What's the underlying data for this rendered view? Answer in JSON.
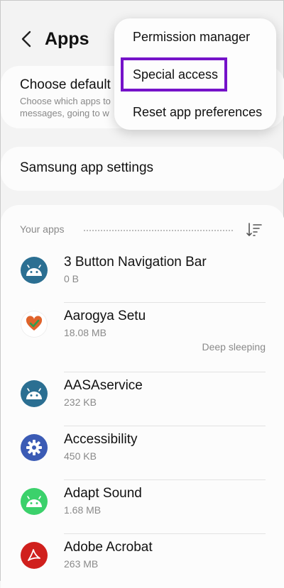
{
  "header": {
    "title": "Apps"
  },
  "choose_default": {
    "title": "Choose default",
    "subtitle": "Choose which apps to messages, going to w"
  },
  "samsung_settings": {
    "label": "Samsung app settings"
  },
  "your_apps": {
    "label": "Your apps"
  },
  "apps": [
    {
      "name": "3 Button Navigation Bar",
      "size": "0 B",
      "icon": "android-icon",
      "color": "#2b6f92"
    },
    {
      "name": "Aarogya Setu",
      "size": "18.08 MB",
      "status": "Deep sleeping",
      "icon": "heart-icon",
      "color": "#e0632b"
    },
    {
      "name": "AASAservice",
      "size": "232 KB",
      "icon": "android-icon",
      "color": "#2b6f92"
    },
    {
      "name": "Accessibility",
      "size": "450 KB",
      "icon": "gear-icon",
      "color": "#3b5bb5"
    },
    {
      "name": "Adapt Sound",
      "size": "1.68 MB",
      "icon": "android-icon",
      "color": "#3bd16b"
    },
    {
      "name": "Adobe Acrobat",
      "size": "263 MB",
      "icon": "acrobat-icon",
      "color": "#d0201d"
    }
  ],
  "menu": {
    "items": [
      "Permission manager",
      "Special access",
      "Reset app preferences"
    ],
    "highlight_color": "#7512c9"
  }
}
